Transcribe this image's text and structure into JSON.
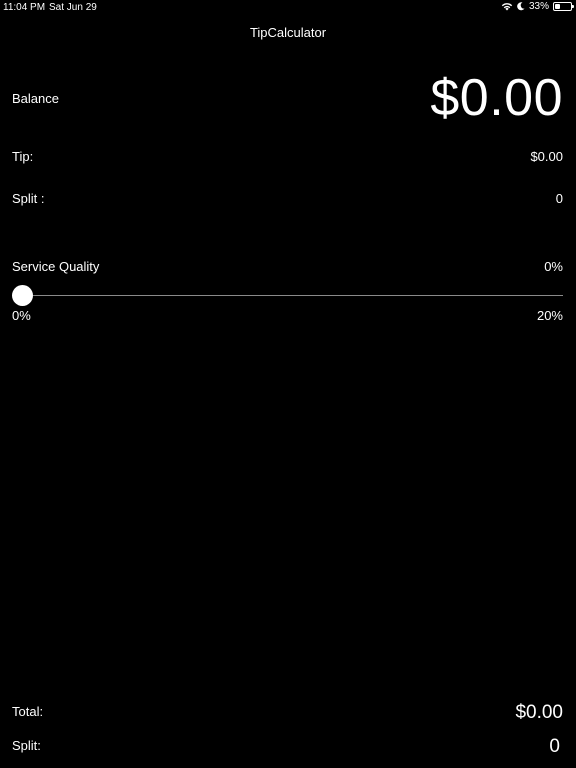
{
  "status_bar": {
    "time": "11:04 PM",
    "date": "Sat Jun 29",
    "battery_percent": "33%",
    "battery_level": 0.33
  },
  "nav": {
    "title": "TipCalculator"
  },
  "balance": {
    "label": "Balance",
    "value": "$0.00"
  },
  "tip": {
    "label": "Tip:",
    "value": "$0.00"
  },
  "split": {
    "label": "Split :",
    "value": "0"
  },
  "service_quality": {
    "label": "Service Quality",
    "value": "0%",
    "slider": {
      "min_label": "0%",
      "max_label": "20%",
      "level": 0
    }
  },
  "footer": {
    "total_label": "Total:",
    "total_value": "$0.00",
    "split_label": "Split:",
    "split_value": "0"
  },
  "icons": [
    "wifi-icon",
    "moon-icon",
    "battery-icon"
  ],
  "colors": {
    "background": "#000000",
    "text": "#ffffff",
    "track": "#8a8a8a"
  }
}
